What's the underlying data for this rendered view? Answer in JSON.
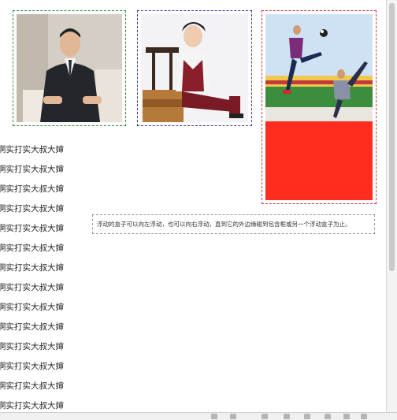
{
  "images": [
    {
      "alt": "man-in-suit-photo"
    },
    {
      "alt": "young-man-photo"
    },
    {
      "alt": "soccer-kick-photo"
    }
  ],
  "caption": "浮动的盒子可以向左浮动，也可以向右浮动，直到它的外边缘碰到包含框或另一个浮动盒子为止。",
  "text_lines": [
    "啊实打实大叔大婶",
    "啊实打实大叔大婶",
    "啊实打实大叔大婶",
    "啊实打实大叔大婶",
    "啊实打实大叔大婶",
    "啊实打实大叔大婶",
    "啊实打实大叔大婶",
    "啊实打实大叔大婶",
    "啊实打实大叔大婶",
    "啊实打实大叔大婶",
    "啊实打实大叔大婶",
    "啊实打实大叔大婶",
    "啊实打实大叔大婶",
    "啊实打实大叔大婶",
    "啊实打实大叔大婶"
  ],
  "colors": {
    "red_block": "#ff2d20",
    "box1_border": "#3c8a3c",
    "box2_border": "#3a3ab8",
    "box3_border": "#c23a3a"
  }
}
